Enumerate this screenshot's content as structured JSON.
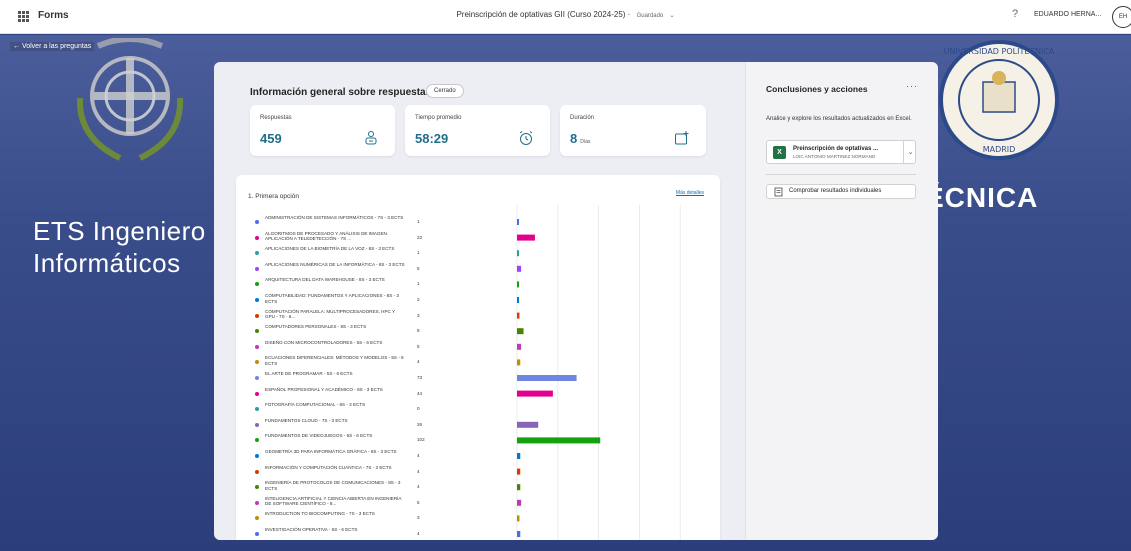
{
  "topbar": {
    "app_name": "Forms",
    "doc_title": "Preinscripción de optativas GII (Curso 2024-25)",
    "save_state": "Guardado",
    "help_symbol": "?",
    "user_name": "EDUARDO HERNA...",
    "user_initials": "EH"
  },
  "navigation": {
    "back_label": "← Volver a las preguntas"
  },
  "background": {
    "banner_left_line1": "ETS Ingeniero",
    "banner_left_line2": "Informáticos",
    "banner_right": "LITÉCNICA",
    "seal_top_text": "UNIVERSIDAD POLITECNICA",
    "seal_bottom_text": "MADRID"
  },
  "overview": {
    "title": "Información general sobre respuestas",
    "status_badge": "Cerrado",
    "cards": [
      {
        "label": "Respuestas",
        "value": "459",
        "unit": "",
        "icon": "respondents-icon"
      },
      {
        "label": "Tiempo promedio",
        "value": "58:29",
        "unit": "",
        "icon": "alarm-clock-icon"
      },
      {
        "label": "Duración",
        "value": "8",
        "unit": "Días",
        "icon": "calendar-add-icon"
      }
    ]
  },
  "question": {
    "title": "1. Primera opción",
    "details_link": "Más detalles"
  },
  "colors": {
    "accent": "#1f6f8b",
    "link": "#0f6cbd",
    "excel": "#217346"
  },
  "chart_data": {
    "type": "bar",
    "orientation": "horizontal",
    "xlim": [
      0,
      250
    ],
    "grid": true,
    "items": [
      {
        "label": "ADMINISTRACIÓN DE SISTEMAS INFORMÁTICOS - 7S - 3 ECTS",
        "value": 1,
        "color": "#4f6bed"
      },
      {
        "label": "ALGORITMOS DE PROCESADO Y ANÁLISIS DE IMAGEN. APLICACIÓN A TELEDETECCIÓN - 7S ...",
        "value": 22,
        "color": "#e3008c"
      },
      {
        "label": "APLICACIONES DE LA BIOMETRÍA DE LA VOZ - 8S - 3 ECTS",
        "value": 1,
        "color": "#2aa0a4"
      },
      {
        "label": "APLICACIONES NUMÉRICAS DE LA INFORMÁTICA - 8S - 3 ECTS",
        "value": 5,
        "color": "#9a44fc"
      },
      {
        "label": "ARQUITECTURA DEL DATA WAREHOUSE - 8S - 3 ECTS",
        "value": 1,
        "color": "#13a10e"
      },
      {
        "label": "COMPUTABILIDAD: FUNDAMENTOS Y APLICACIONES - 8S - 3 ECTS",
        "value": 2,
        "color": "#0078d4"
      },
      {
        "label": "COMPUTACIÓN PARALELA: MULTIPROCESADORES, HPC y GPU - 7S - 6...",
        "value": 3,
        "color": "#d83b01"
      },
      {
        "label": "COMPUTADORES PERSONALES - 8S - 3 ECTS",
        "value": 8,
        "color": "#498205"
      },
      {
        "label": "DISEÑO CON MICROCONTROLADORES - 5S - 6 ECTS",
        "value": 5,
        "color": "#c239b3"
      },
      {
        "label": "ECUACIONES DIFERENCIALES: MÉTODOS Y MODELOS - 5S - 6 ECTS",
        "value": 4,
        "color": "#bf8f00"
      },
      {
        "label": "EL ARTE DE PROGRAMAR - 5S - 6 ECTS",
        "value": 73,
        "color": "#6f86e0"
      },
      {
        "label": "ESPAÑOL PROFESIONAL Y ACADÉMICO - 8S - 3 ECTS",
        "value": 44,
        "color": "#e3008c"
      },
      {
        "label": "FOTOGRAFÍA COMPUTACIONAL - 8S - 3 ECTS",
        "value": 0,
        "color": "#2aa0a4"
      },
      {
        "label": "FUNDAMENTOS CLOUD - 7S - 3 ECTS",
        "value": 26,
        "color": "#8764b8"
      },
      {
        "label": "FUNDAMENTOS DE VIDEOJUEGOS - 5S - 6 ECTS",
        "value": 102,
        "color": "#13a10e"
      },
      {
        "label": "GEOMETRÍA 3D PARA INFORMÁTICA GRÁFICA - 8S - 3 ECTS",
        "value": 4,
        "color": "#0078d4"
      },
      {
        "label": "INFORMACIÓN Y COMPUTACIÓN CUÁNTICA - 7S - 3 ECTS",
        "value": 4,
        "color": "#d83b01"
      },
      {
        "label": "INGENIERÍA DE PROTOCOLOS DE COMUNICACIONES - 8S - 3 ECTS",
        "value": 4,
        "color": "#498205"
      },
      {
        "label": "INTELIGENCIA ARTIFICIAL Y CIENCIA ABIERTA EN INGENIERÍA DE SOFTWARE CIENTÍFICO - 8...",
        "value": 5,
        "color": "#c239b3"
      },
      {
        "label": "INTRODUCTION TO BIOCOMPUTING - 7S - 3 ECTS",
        "value": 3,
        "color": "#bf8f00"
      },
      {
        "label": "INVESTIGACIÓN OPERATIVA - 5S - 6 ECTS",
        "value": 4,
        "color": "#4f6bed"
      }
    ]
  },
  "side": {
    "title": "Conclusiones y acciones",
    "more_symbol": "···",
    "description": "Analice y explore los resultados actualizados en Excel.",
    "excel_file": {
      "name": "Preinscripción de optativas ...",
      "owner": "LOIC ANTONIO MARTINEZ NORMAND",
      "icon_letter": "X",
      "chevron": "⌄"
    },
    "check_button": "Comprobar resultados individuales"
  }
}
